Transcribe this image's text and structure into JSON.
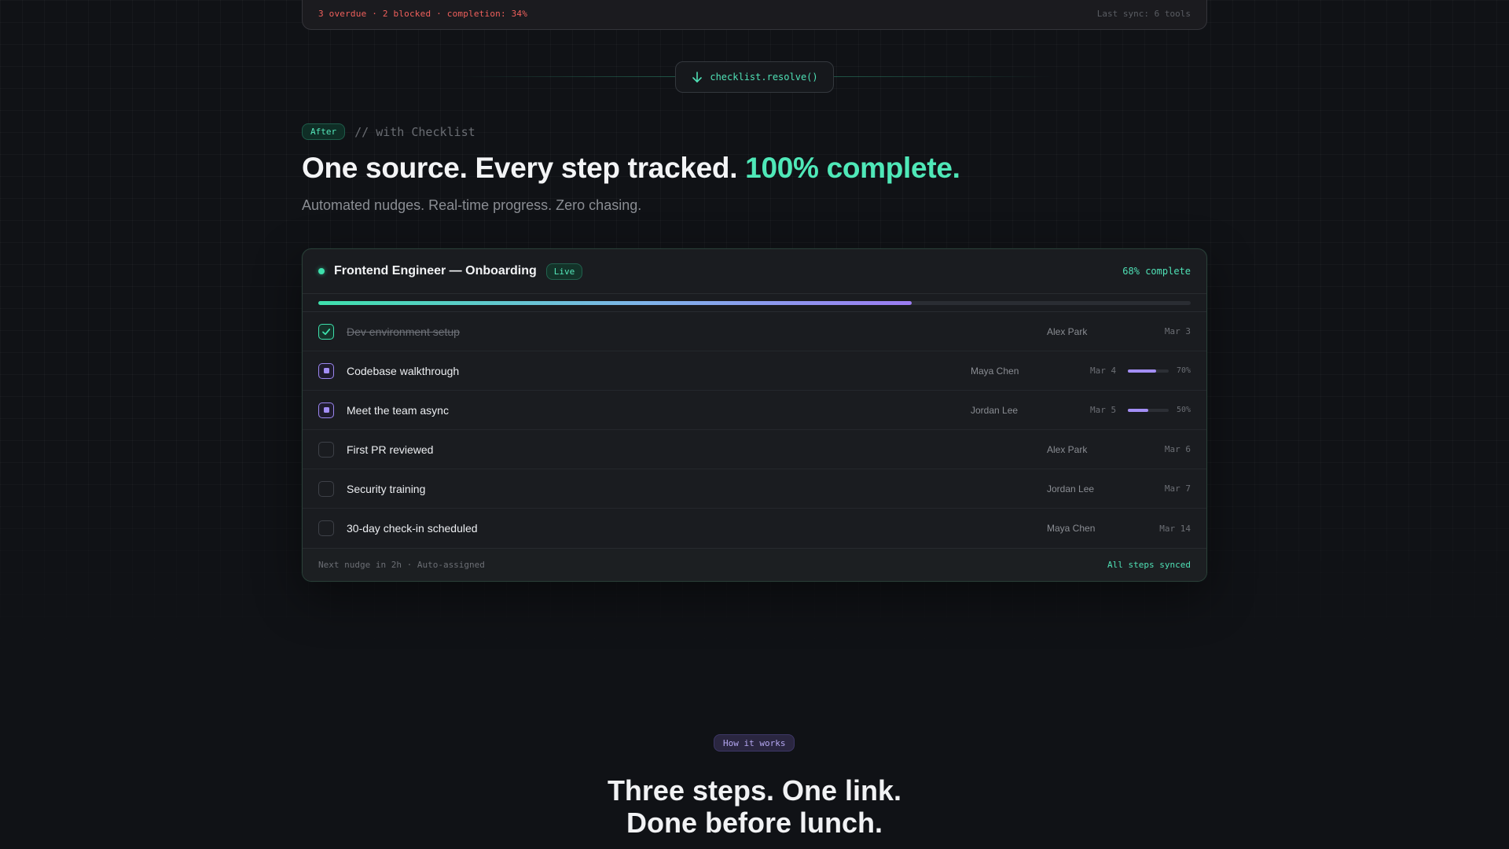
{
  "before": {
    "status_line": "3 overdue · 2 blocked · completion: 34%",
    "sync_text": "Last sync: 6 tools"
  },
  "transition": {
    "label": "checklist.resolve()",
    "icon": "arrow-down-icon"
  },
  "after": {
    "badge": "After",
    "comment": "// with Checklist",
    "headline_main": "One source. Every step tracked. ",
    "headline_accent": "100% complete.",
    "subline": "Automated nudges. Real-time progress. Zero chasing."
  },
  "checklist": {
    "title": "Frontend Engineer — Onboarding",
    "live_badge": "Live",
    "complete_text": "68% complete",
    "progress": 0.68,
    "tasks": [
      {
        "label": "Dev environment setup",
        "owner": "Alex Park",
        "date": "Mar 3",
        "status": "done"
      },
      {
        "label": "Codebase walkthrough",
        "owner": "Maya Chen",
        "date": "Mar 4",
        "status": "in-progress",
        "percent_label": "70%",
        "percent": 0.7
      },
      {
        "label": "Meet the team async",
        "owner": "Jordan Lee",
        "date": "Mar 5",
        "status": "in-progress",
        "percent_label": "50%",
        "percent": 0.5
      },
      {
        "label": "First PR reviewed",
        "owner": "Alex Park",
        "date": "Mar 6",
        "status": "todo"
      },
      {
        "label": "Security training",
        "owner": "Jordan Lee",
        "date": "Mar 7",
        "status": "todo"
      },
      {
        "label": "30-day check-in scheduled",
        "owner": "Maya Chen",
        "date": "Mar 14",
        "status": "todo"
      }
    ],
    "footer_left": "Next nudge in 2h · Auto-assigned",
    "footer_right": "All steps synced"
  },
  "how": {
    "badge": "How it works",
    "title_line1": "Three steps. One link.",
    "title_line2": "Done before lunch."
  },
  "colors": {
    "accent_green": "#4fe8b8",
    "accent_purple": "#a38ef5",
    "alert_red": "#f0605c",
    "background": "#101216"
  }
}
